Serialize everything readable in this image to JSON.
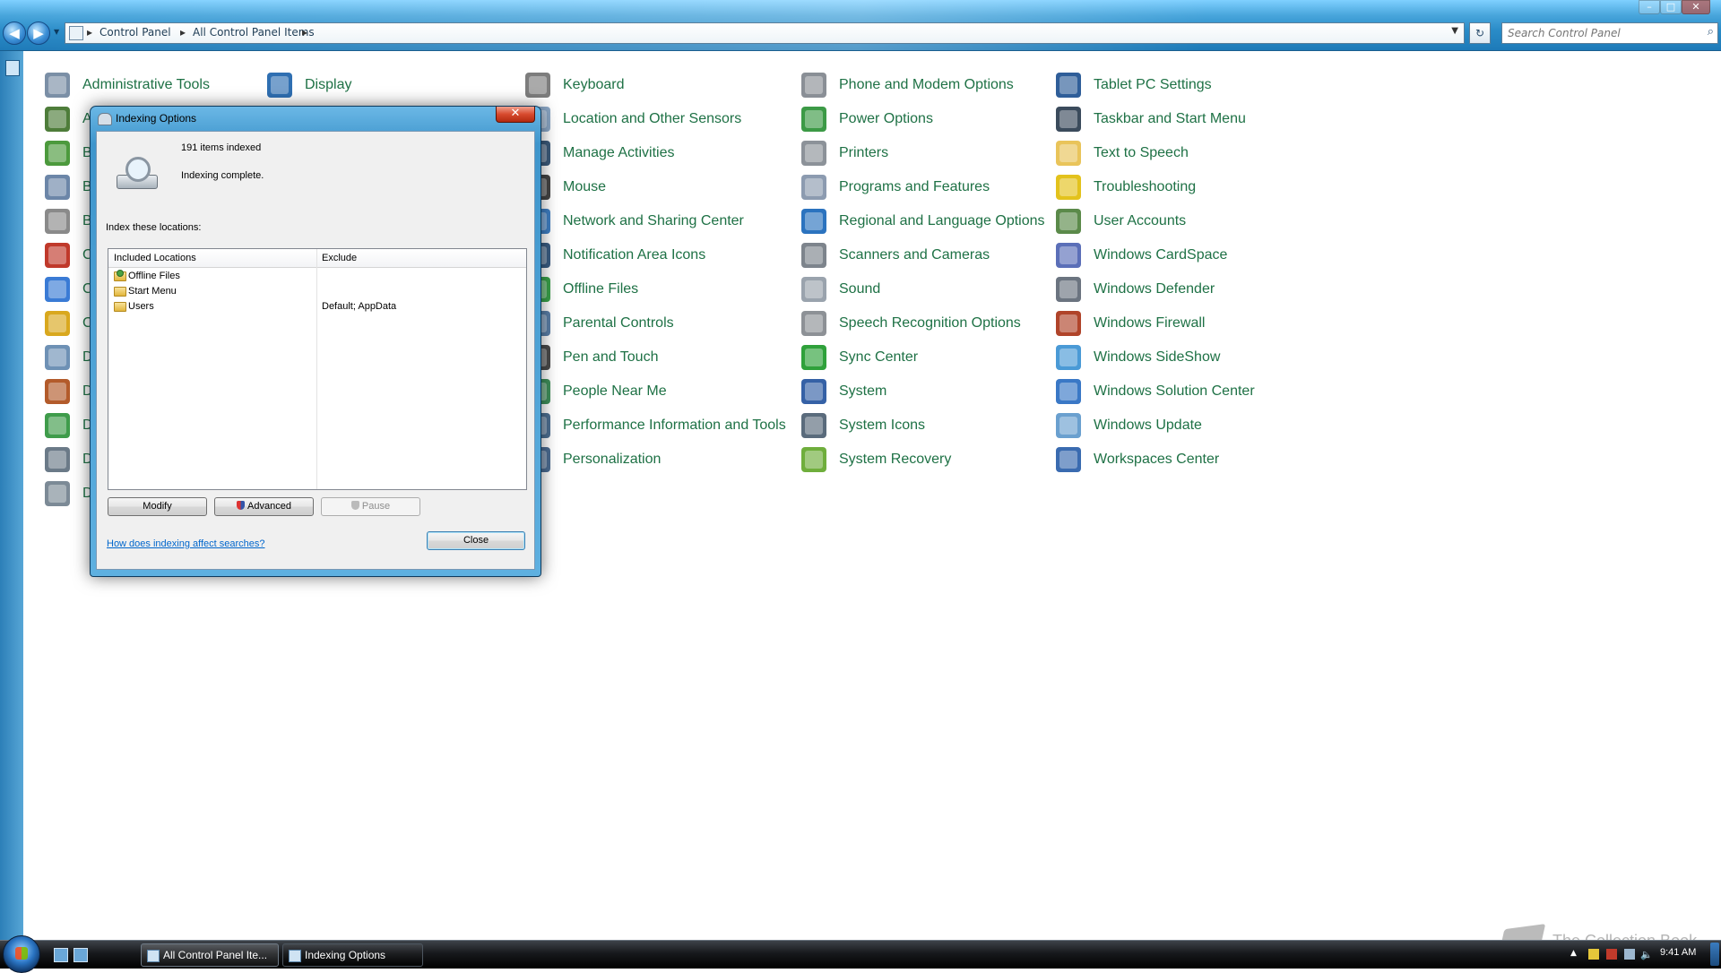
{
  "window": {
    "controls": [
      "–",
      "□",
      "✕"
    ]
  },
  "address": {
    "crumbs": [
      "Control Panel",
      "All Control Panel Items"
    ],
    "separator": "▸"
  },
  "search": {
    "placeholder": "Search Control Panel"
  },
  "control_panel": {
    "items": [
      {
        "label": "Administrative Tools",
        "icon": "administrative-tools-icon",
        "color": "#7b8fa6"
      },
      {
        "label": "A",
        "icon": "autoplay-icon",
        "color": "#4e7d3a"
      },
      {
        "label": "B",
        "icon": "backup-restore-icon",
        "color": "#4c9a3d"
      },
      {
        "label": "B",
        "icon": "biometric-devices-icon",
        "color": "#6c86a8"
      },
      {
        "label": "B",
        "icon": "bluetooth-devices-icon",
        "color": "#8a8a8a"
      },
      {
        "label": "C",
        "icon": "color-management-icon",
        "color": "#c0392b"
      },
      {
        "label": "C",
        "icon": "credential-manager-icon",
        "color": "#3a7bd5"
      },
      {
        "label": "C",
        "icon": "customize-search-icon",
        "color": "#d9a81e"
      },
      {
        "label": "D",
        "icon": "date-and-time-icon",
        "color": "#6e91b5"
      },
      {
        "label": "D",
        "icon": "default-location-icon",
        "color": "#b35b2b"
      },
      {
        "label": "D",
        "icon": "default-programs-icon",
        "color": "#3f9c4b"
      },
      {
        "label": "D",
        "icon": "device-manager-icon",
        "color": "#6b7a88"
      },
      {
        "label": "D",
        "icon": "devices-and-printers-icon",
        "color": "#7c8a96"
      },
      {
        "label": "Display",
        "icon": "display-icon",
        "color": "#2f6fb2"
      },
      {
        "label": "Keyboard",
        "icon": "keyboard-icon",
        "color": "#7d7d7d"
      },
      {
        "label": "Location and Other Sensors",
        "icon": "location-sensors-icon",
        "color": "#8ba7c6"
      },
      {
        "label": "Manage Activities",
        "icon": "manage-activities-icon",
        "color": "#3c5a7a"
      },
      {
        "label": "Mouse",
        "icon": "mouse-icon",
        "color": "#444444"
      },
      {
        "label": "Network and Sharing Center",
        "icon": "network-sharing-icon",
        "color": "#3f7ec2"
      },
      {
        "label": "Notification Area Icons",
        "icon": "notification-area-icon",
        "color": "#3a5c82"
      },
      {
        "label": "Offline Files",
        "icon": "offline-files-icon",
        "color": "#3aa14a"
      },
      {
        "label": "Parental Controls",
        "icon": "parental-controls-icon",
        "color": "#5a7ea6"
      },
      {
        "label": "Pen and Touch",
        "icon": "pen-touch-icon",
        "color": "#4a4a4a"
      },
      {
        "label": "People Near Me",
        "icon": "people-near-me-icon",
        "color": "#3f8f5a"
      },
      {
        "label": "Performance Information and Tools",
        "icon": "performance-icon",
        "color": "#4d6f91"
      },
      {
        "label": "Personalization",
        "icon": "personalization-icon",
        "color": "#4c6c92"
      },
      {
        "label": "Phone and Modem Options",
        "icon": "phone-modem-icon",
        "color": "#8a8f96"
      },
      {
        "label": "Power Options",
        "icon": "power-options-icon",
        "color": "#3c9a46"
      },
      {
        "label": "Printers",
        "icon": "printers-icon",
        "color": "#8c9299"
      },
      {
        "label": "Programs and Features",
        "icon": "programs-features-icon",
        "color": "#8c9bb0"
      },
      {
        "label": "Regional and Language Options",
        "icon": "regional-language-icon",
        "color": "#2b73bf"
      },
      {
        "label": "Scanners and Cameras",
        "icon": "scanners-cameras-icon",
        "color": "#7d848c"
      },
      {
        "label": "Sound",
        "icon": "sound-icon",
        "color": "#9aa3ad"
      },
      {
        "label": "Speech Recognition Options",
        "icon": "microphone-icon",
        "color": "#8d9196"
      },
      {
        "label": "Sync Center",
        "icon": "sync-center-icon",
        "color": "#2fa13b"
      },
      {
        "label": "System",
        "icon": "system-icon",
        "color": "#3561a6"
      },
      {
        "label": "System Icons",
        "icon": "system-icons-icon",
        "color": "#5a6b7c"
      },
      {
        "label": "System Recovery",
        "icon": "system-recovery-icon",
        "color": "#6fae3c"
      },
      {
        "label": "Tablet PC Settings",
        "icon": "tablet-pc-icon",
        "color": "#2f5e99"
      },
      {
        "label": "Taskbar and Start Menu",
        "icon": "taskbar-start-menu-icon",
        "color": "#3b4b5c"
      },
      {
        "label": "Text to Speech",
        "icon": "text-to-speech-icon",
        "color": "#e9c45a"
      },
      {
        "label": "Troubleshooting",
        "icon": "troubleshooting-icon",
        "color": "#e3c21c"
      },
      {
        "label": "User Accounts",
        "icon": "user-accounts-icon",
        "color": "#5b8a4a"
      },
      {
        "label": "Windows CardSpace",
        "icon": "cardspace-icon",
        "color": "#5b6fb8"
      },
      {
        "label": "Windows Defender",
        "icon": "windows-defender-icon",
        "color": "#6b7480"
      },
      {
        "label": "Windows Firewall",
        "icon": "windows-firewall-icon",
        "color": "#b0442a"
      },
      {
        "label": "Windows SideShow",
        "icon": "windows-sideshow-icon",
        "color": "#4a9ad6"
      },
      {
        "label": "Windows Solution Center",
        "icon": "shield-icon",
        "color": "#3a78c6"
      },
      {
        "label": "Windows Update",
        "icon": "windows-update-icon",
        "color": "#6aa0cf"
      },
      {
        "label": "Workspaces Center",
        "icon": "workspaces-center-icon",
        "color": "#3a6bb0"
      }
    ],
    "text_color": "#1e7145"
  },
  "dialog": {
    "title": "Indexing Options",
    "close_glyph": "✕",
    "items_indexed": "191 items indexed",
    "status": "Indexing complete.",
    "index_label": "Index these locations:",
    "columns": {
      "included": "Included Locations",
      "exclude": "Exclude"
    },
    "rows": [
      {
        "name": "Offline Files",
        "exclude": ""
      },
      {
        "name": "Start Menu",
        "exclude": ""
      },
      {
        "name": "Users",
        "exclude": "Default; AppData"
      }
    ],
    "buttons": {
      "modify": "Modify",
      "advanced": "Advanced",
      "pause": "Pause",
      "close": "Close"
    },
    "help_link": "How does indexing affect searches?"
  },
  "taskbar": {
    "buttons": [
      {
        "label": "All Control Panel Ite...",
        "active": false
      },
      {
        "label": "Indexing Options",
        "active": true
      }
    ],
    "clock": "9:41 AM"
  },
  "watermark": "The Collection Book",
  "colors": {
    "accent": "#2a8cc8",
    "link": "#0066cc",
    "item_text": "#1e7145"
  }
}
